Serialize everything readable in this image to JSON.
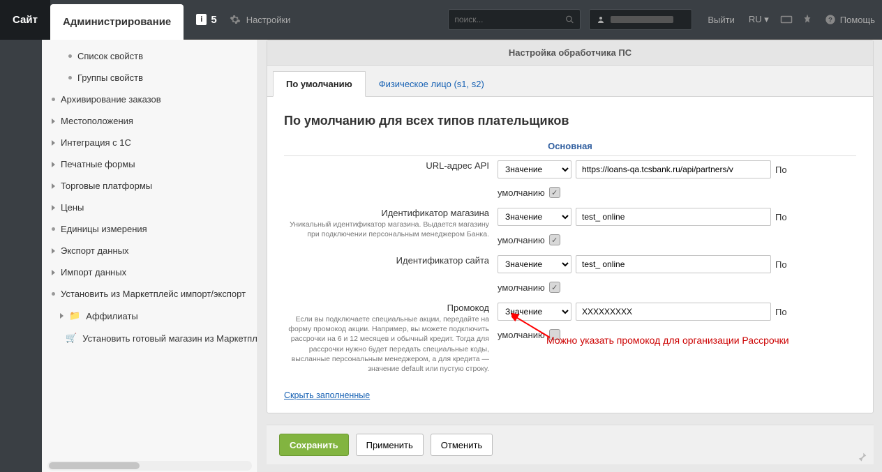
{
  "topbar": {
    "site_tab": "Сайт",
    "admin_tab": "Администрирование",
    "notif_count": "5",
    "settings_label": "Настройки",
    "search_placeholder": "поиск...",
    "logout": "Выйти",
    "lang": "RU",
    "help": "Помощь"
  },
  "tree": {
    "items": [
      {
        "label": "Список свойств",
        "lvl": 2,
        "marker": "bullet"
      },
      {
        "label": "Группы свойств",
        "lvl": 2,
        "marker": "bullet"
      },
      {
        "label": "Архивирование заказов",
        "lvl": 1,
        "marker": "bullet"
      },
      {
        "label": "Местоположения",
        "lvl": 1,
        "marker": "arrow"
      },
      {
        "label": "Интеграция с 1С",
        "lvl": 1,
        "marker": "arrow"
      },
      {
        "label": "Печатные формы",
        "lvl": 1,
        "marker": "arrow"
      },
      {
        "label": "Торговые платформы",
        "lvl": 1,
        "marker": "arrow"
      },
      {
        "label": "Цены",
        "lvl": 1,
        "marker": "arrow"
      },
      {
        "label": "Единицы измерения",
        "lvl": 1,
        "marker": "bullet"
      },
      {
        "label": "Экспорт данных",
        "lvl": 1,
        "marker": "arrow"
      },
      {
        "label": "Импорт данных",
        "lvl": 1,
        "marker": "arrow"
      },
      {
        "label": "Установить из Маркетплейс импорт/экспорт",
        "lvl": 1,
        "marker": "bullet"
      },
      {
        "label": "Аффилиаты",
        "lvl": 0,
        "marker": "arrow",
        "icon": "folder"
      },
      {
        "label": "Установить готовый магазин из Маркетплейс",
        "lvl": 0,
        "marker": "bullet",
        "icon": "cart"
      }
    ]
  },
  "panel": {
    "header": "Настройка обработчика ПС",
    "tabs": {
      "active": "По умолчанию",
      "inactive": "Физическое лицо (s1, s2)"
    },
    "title": "По умолчанию для всех типов плательщиков",
    "subsection": "Основная",
    "default_suffix_before": "По",
    "default_suffix_after": "умолчанию",
    "select_option": "Значение",
    "rows": [
      {
        "label": "URL-адрес API",
        "hint": "",
        "value": "https://loans-qa.tcsbank.ru/api/partners/v",
        "checked": true
      },
      {
        "label": "Идентификатор магазина",
        "hint": "Уникальный идентификатор магазина. Выдается магазину при подключении персональным менеджером Банка.",
        "value": "test_ online",
        "checked": true
      },
      {
        "label": "Идентификатор сайта",
        "hint": "",
        "value": "test_ online",
        "checked": true
      },
      {
        "label": "Промокод",
        "hint": "Если вы подключаете специальные акции, передайте на форму промокод акции. Например, вы можете подключить рассрочки на 6 и 12 месяцев и обычный кредит. Тогда для рассрочки нужно будет передать специальные коды, высланные персональным менеджером, а для кредита — значение default или пустую строку.",
        "value": "XXXXXXXXX",
        "checked": false
      }
    ],
    "collapse_link": "Скрыть заполненные",
    "annotation": "Можно указать промокод для организации Рассрочки"
  },
  "footer": {
    "save": "Сохранить",
    "apply": "Применить",
    "cancel": "Отменить"
  }
}
